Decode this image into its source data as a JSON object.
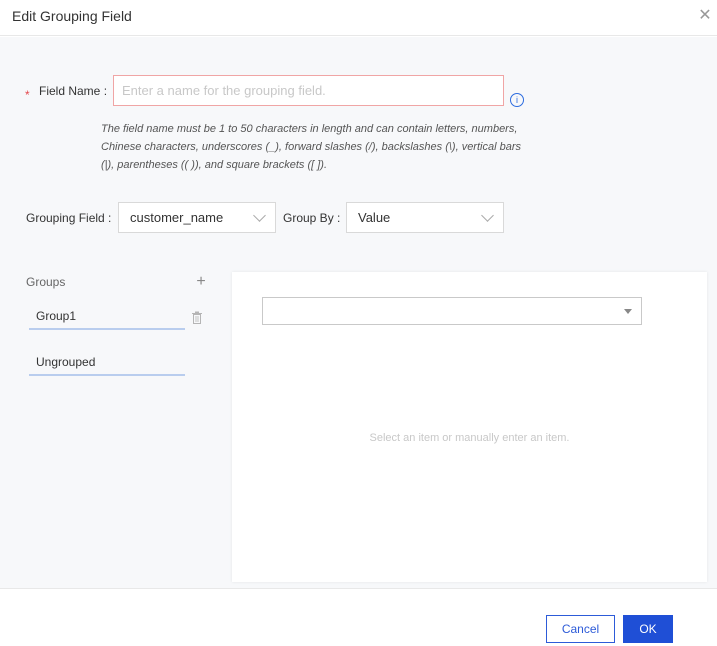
{
  "dialog": {
    "title": "Edit Grouping Field",
    "close_icon": "close-icon"
  },
  "field_name": {
    "label": "Field Name :",
    "required_mark": "*",
    "placeholder": "Enter a name for the grouping field.",
    "value": "",
    "info_icon": "info-circle-icon",
    "info_glyph": "i",
    "hint": "The field name must be 1 to 50 characters in length and can contain letters, numbers, Chinese characters, underscores (_), forward slashes (/), backslashes (\\), vertical bars (|), parentheses (( )), and square brackets ([ ])."
  },
  "grouping_field": {
    "label": "Grouping Field :",
    "value": "customer_name"
  },
  "group_by": {
    "label": "Group By :",
    "value": "Value"
  },
  "groups": {
    "title": "Groups",
    "items": [
      {
        "label": "Group1"
      },
      {
        "label": "Ungrouped"
      }
    ]
  },
  "panel": {
    "select_value": "",
    "empty_text": "Select an item or manually enter an item."
  },
  "footer": {
    "cancel_label": "Cancel",
    "ok_label": "OK"
  },
  "colors": {
    "primary": "#1f4fd6",
    "required": "#e5484d",
    "input_error_border": "#f0a5a5"
  }
}
